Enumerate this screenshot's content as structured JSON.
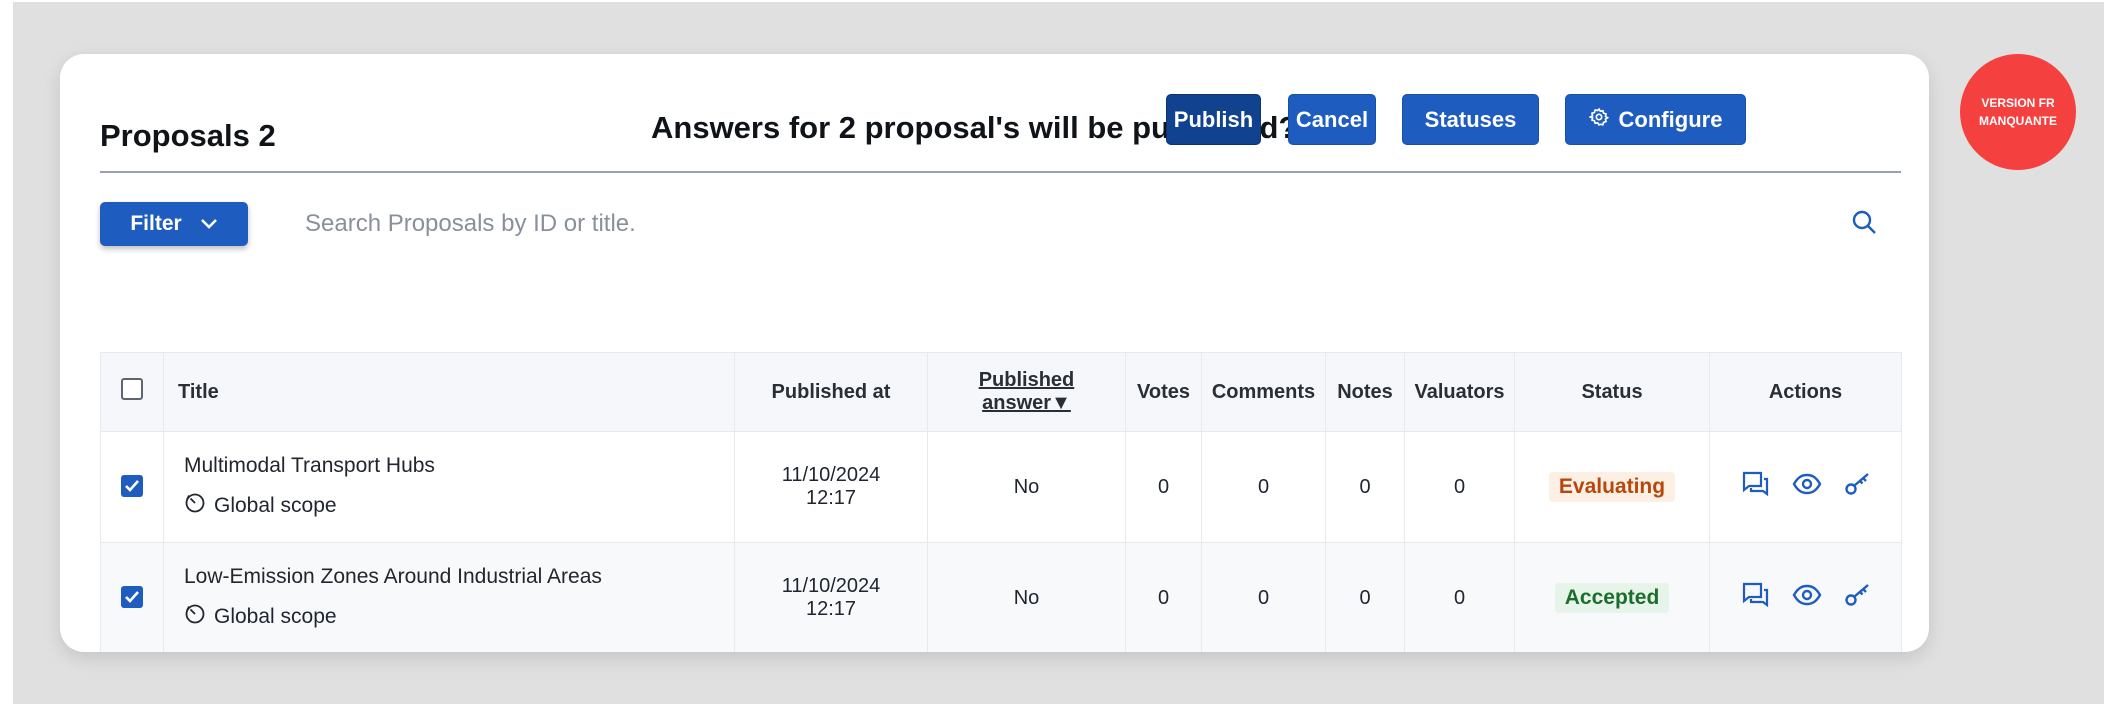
{
  "header": {
    "title": "Proposals 2",
    "confirm_text": "Answers for 2 proposal's will be published?",
    "publish_label": "Publish",
    "cancel_label": "Cancel",
    "statuses_label": "Statuses",
    "configure_label": "Configure"
  },
  "filter": {
    "label": "Filter"
  },
  "search": {
    "placeholder": "Search Proposals by ID or title."
  },
  "table": {
    "columns": [
      "Title",
      "Published at",
      "Published",
      "answer",
      "Votes",
      "Comments",
      "Notes",
      "Valuators",
      "Status",
      "Actions"
    ],
    "rows": [
      {
        "checked": true,
        "title": "Multimodal Transport Hubs",
        "scope": "Global scope",
        "published_date": "11/10/2024",
        "published_time": "12:17",
        "published_answer": "No",
        "votes": "0",
        "comments": "0",
        "notes": "0",
        "valuators": "0",
        "status": "Evaluating"
      },
      {
        "checked": true,
        "title": "Low-Emission Zones Around Industrial Areas",
        "scope": "Global scope",
        "published_date": "11/10/2024",
        "published_time": "12:17",
        "published_answer": "No",
        "votes": "0",
        "comments": "0",
        "notes": "0",
        "valuators": "0",
        "status": "Accepted"
      }
    ]
  },
  "version_badge": {
    "line1": "VERSION FR",
    "line2": "MANQUANTE"
  },
  "icons": {
    "filter": "chevron-down-icon",
    "search": "search-icon",
    "configure": "gear-icon",
    "scope": "scope-icon",
    "actions": [
      "comments-icon",
      "eye-icon",
      "key-icon"
    ]
  },
  "colors": {
    "primary": "#1e5cc0",
    "primary_dark": "#11428f",
    "evaluating": "#b7480d",
    "accepted": "#1d6e2e",
    "version_badge": "#f54040"
  }
}
